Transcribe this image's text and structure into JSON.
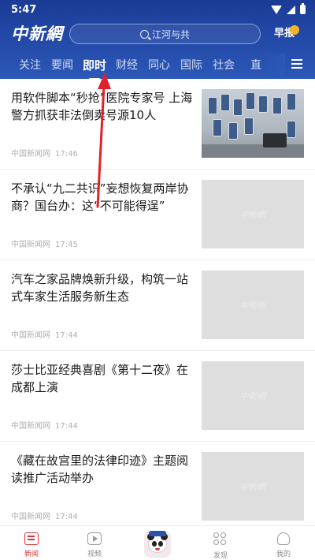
{
  "status_bar": {
    "time": "5:47"
  },
  "header": {
    "logo": "中新網",
    "search": {
      "placeholder": "江河与共"
    },
    "early_report": "早报"
  },
  "tabs": [
    {
      "label": "关注",
      "active": false
    },
    {
      "label": "要闻",
      "active": false
    },
    {
      "label": "即时",
      "active": true
    },
    {
      "label": "财经",
      "active": false
    },
    {
      "label": "同心",
      "active": false
    },
    {
      "label": "国际",
      "active": false
    },
    {
      "label": "社会",
      "active": false
    },
    {
      "label": "直",
      "active": false
    }
  ],
  "feed": [
    {
      "title": "用软件脚本“秒抢”医院专家号 上海警方抓获非法倒卖号源10人",
      "source": "中国新闻网",
      "time": "17:46",
      "thumb": "photo"
    },
    {
      "title": "不承认“九二共识”妄想恢复两岸协商？国台办：这“不可能得逞”",
      "source": "中国新闻网",
      "time": "17:45",
      "thumb": "placeholder"
    },
    {
      "title": "汽车之家品牌焕新升级，构筑一站式车家生活服务新生态",
      "source": "中国新闻网",
      "time": "17:44",
      "thumb": "placeholder"
    },
    {
      "title": "莎士比亚经典喜剧《第十二夜》在成都上演",
      "source": "中国新闻网",
      "time": "17:44",
      "thumb": "placeholder"
    },
    {
      "title": "《藏在故宫里的法律印迹》主题阅读推广活动举办",
      "source": "中国新闻网",
      "time": "17:44",
      "thumb": "placeholder"
    }
  ],
  "thumb_watermark": "中新網",
  "bottom_nav": [
    {
      "label": "新闻",
      "icon": "news-icon",
      "active": true
    },
    {
      "label": "视频",
      "icon": "video-icon",
      "active": false
    },
    {
      "label": "",
      "icon": "panda-mascot-icon",
      "active": false
    },
    {
      "label": "发现",
      "icon": "discover-icon",
      "active": false
    },
    {
      "label": "我的",
      "icon": "profile-icon",
      "active": false
    }
  ],
  "colors": {
    "header_top": "#1a3b96",
    "header_bottom": "#2c58b8",
    "accent_red": "#d9333a",
    "annotation_arrow": "#e0212b",
    "early_badge": "#f5b32c"
  }
}
